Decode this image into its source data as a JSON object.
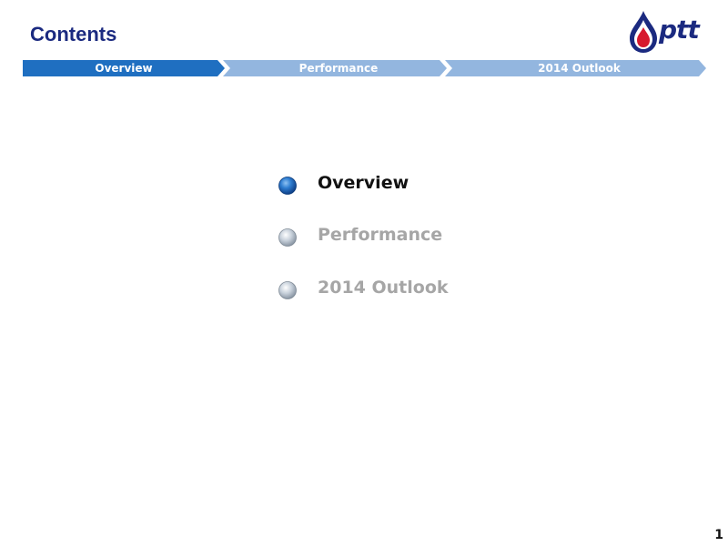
{
  "header": {
    "title": "Contents"
  },
  "logo": {
    "text": "ptt",
    "icon": "flame-drop-icon",
    "colors": {
      "blue": "#1b2a80",
      "red": "#d7192e"
    }
  },
  "stepbar": {
    "steps": [
      {
        "label": "Overview",
        "state": "active"
      },
      {
        "label": "Performance",
        "state": "inactive"
      },
      {
        "label": "2014 Outlook",
        "state": "inactive"
      }
    ],
    "colors": {
      "active": "#1f6fc1",
      "inactive": "#93b6df"
    }
  },
  "agenda": {
    "items": [
      {
        "label": "Overview",
        "state": "active"
      },
      {
        "label": "Performance",
        "state": "inactive"
      },
      {
        "label": "2014 Outlook",
        "state": "inactive"
      }
    ]
  },
  "footer": {
    "page_number": "1"
  }
}
